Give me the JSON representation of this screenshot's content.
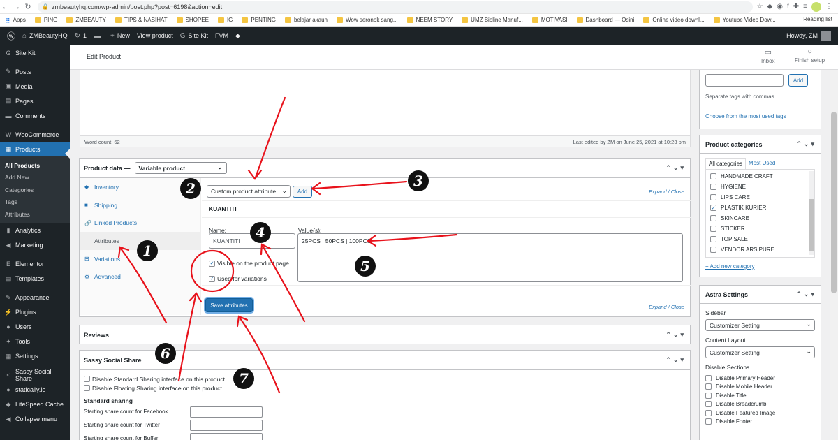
{
  "browser": {
    "url": "zmbeautyhq.com/wp-admin/post.php?post=6198&action=edit",
    "reading_list": "Reading list",
    "bookmarks": [
      "Apps",
      "PING",
      "ZMBEAUTY",
      "TIPS & NASIHAT",
      "SHOPEE",
      "IG",
      "PENTING",
      "belajar akaun",
      "Wow seronok sang...",
      "NEEM STORY",
      "UMZ Bioline Manuf...",
      "MOTIVASI",
      "Dashboard — Osini",
      "Online video downl...",
      "Youtube Video Dow..."
    ]
  },
  "adminbar": {
    "site": "ZMBeautyHQ",
    "updates": "1",
    "new": "New",
    "view": "View product",
    "sitekit": "Site Kit",
    "fvm": "FVM",
    "howdy": "Howdy, ZM"
  },
  "sidebar": {
    "items_top": [
      {
        "label": "Site Kit",
        "icon": "G"
      },
      {
        "label": "Posts",
        "icon": "✎"
      },
      {
        "label": "Media",
        "icon": "▣"
      },
      {
        "label": "Pages",
        "icon": "▤"
      },
      {
        "label": "Comments",
        "icon": "▬"
      },
      {
        "label": "WooCommerce",
        "icon": "W"
      },
      {
        "label": "Products",
        "icon": "▦"
      }
    ],
    "submenu": [
      "All Products",
      "Add New",
      "Categories",
      "Tags",
      "Attributes"
    ],
    "items_bottom": [
      {
        "label": "Analytics",
        "icon": "▮"
      },
      {
        "label": "Marketing",
        "icon": "◀"
      },
      {
        "label": "Elementor",
        "icon": "E"
      },
      {
        "label": "Templates",
        "icon": "▤"
      },
      {
        "label": "Appearance",
        "icon": "✎"
      },
      {
        "label": "Plugins",
        "icon": "⚡"
      },
      {
        "label": "Users",
        "icon": "●"
      },
      {
        "label": "Tools",
        "icon": "✦"
      },
      {
        "label": "Settings",
        "icon": "▦"
      },
      {
        "label": "Sassy Social Share",
        "icon": "<"
      },
      {
        "label": "statically.io",
        "icon": "●"
      },
      {
        "label": "LiteSpeed Cache",
        "icon": "◆"
      },
      {
        "label": "Collapse menu",
        "icon": "◀"
      }
    ]
  },
  "header": {
    "title": "Edit Product",
    "inbox": "Inbox",
    "finish": "Finish setup"
  },
  "editor": {
    "word_count": "Word count: 62",
    "last_edited": "Last edited by ZM on June 25, 2021 at 10:23 pm"
  },
  "product_data": {
    "label": "Product data —",
    "type": "Variable product",
    "tabs": [
      "Inventory",
      "Shipping",
      "Linked Products",
      "Attributes",
      "Variations",
      "Advanced"
    ],
    "attr_select": "Custom product attribute",
    "add": "Add",
    "expand": "Expand / Close",
    "attr_title": "KUANTITI",
    "name_label": "Name:",
    "name_value": "KUANTITI",
    "values_label": "Value(s):",
    "values": "25PCS | 50PCS | 100PCS",
    "visible": "Visible on the product page",
    "used": "Used for variations",
    "save": "Save attributes"
  },
  "reviews": {
    "title": "Reviews"
  },
  "sassy": {
    "title": "Sassy Social Share",
    "opt1": "Disable Standard Sharing interface on this product",
    "opt2": "Disable Floating Sharing interface on this product",
    "std": "Standard sharing",
    "fields": [
      "Starting share count for Facebook",
      "Starting share count for Twitter",
      "Starting share count for Buffer"
    ]
  },
  "tags_panel": {
    "add": "Add",
    "hint": "Separate tags with commas",
    "choose": "Choose from the most used tags"
  },
  "categories": {
    "title": "Product categories",
    "tab_all": "All categories",
    "tab_used": "Most Used",
    "items": [
      {
        "label": "HANDMADE CRAFT",
        "checked": false
      },
      {
        "label": "HYGIENE",
        "checked": false
      },
      {
        "label": "LIPS CARE",
        "checked": false
      },
      {
        "label": "PLASTIK KURIER",
        "checked": true
      },
      {
        "label": "SKINCARE",
        "checked": false
      },
      {
        "label": "STICKER",
        "checked": false
      },
      {
        "label": "TOP SALE",
        "checked": false
      },
      {
        "label": "VENDOR ARS PURE",
        "checked": false
      }
    ],
    "add_new": "+ Add new category"
  },
  "astra": {
    "title": "Astra Settings",
    "sidebar_label": "Sidebar",
    "sidebar_value": "Customizer Setting",
    "layout_label": "Content Layout",
    "layout_value": "Customizer Setting",
    "disable_label": "Disable Sections",
    "sections": [
      "Disable Primary Header",
      "Disable Mobile Header",
      "Disable Title",
      "Disable Breadcrumb",
      "Disable Featured Image",
      "Disable Footer"
    ]
  },
  "annotations": {
    "badges": [
      "1",
      "2",
      "3",
      "4",
      "5",
      "6",
      "7"
    ],
    "color": "#e8121b"
  },
  "colors": {
    "wp_dark": "#1d2327",
    "wp_blue": "#2271b1"
  }
}
